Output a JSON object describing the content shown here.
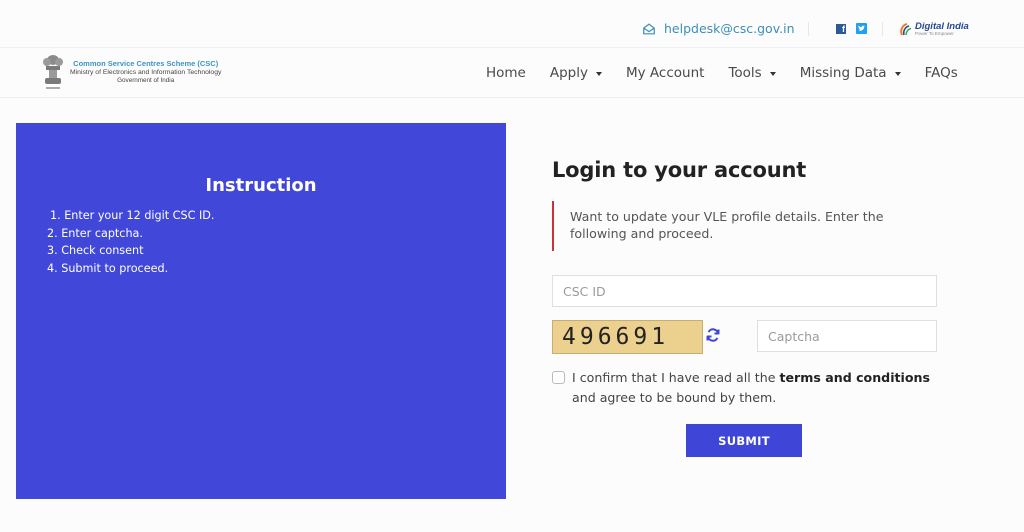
{
  "topbar": {
    "email": "helpdesk@csc.gov.in",
    "social": [
      "facebook",
      "twitter"
    ],
    "digital_india": {
      "title": "Digital India",
      "tagline": "Power To Empower"
    }
  },
  "brand": {
    "line1": "Common Service Centres Scheme (CSC)",
    "line2": "Ministry of Electronics and Information Technology",
    "line3": "Government of India"
  },
  "nav": {
    "items": [
      {
        "label": "Home",
        "dropdown": false
      },
      {
        "label": "Apply",
        "dropdown": true
      },
      {
        "label": "My Account",
        "dropdown": false
      },
      {
        "label": "Tools",
        "dropdown": true
      },
      {
        "label": "Missing Data",
        "dropdown": true
      },
      {
        "label": "FAQs",
        "dropdown": false
      }
    ]
  },
  "instructions": {
    "title": "Instruction",
    "steps": [
      "1. Enter your 12 digit CSC ID.",
      "2. Enter captcha.",
      "3. Check consent",
      "4. Submit to proceed."
    ]
  },
  "login": {
    "title": "Login to your account",
    "notice": "Want to update your VLE profile details. Enter the following and proceed.",
    "csc_id": {
      "placeholder": "CSC ID",
      "value": ""
    },
    "captcha_code": "496691",
    "captcha": {
      "placeholder": "Captcha",
      "value": ""
    },
    "consent": {
      "prefix": "I confirm that I have read all the ",
      "link": "terms and conditions",
      "suffix": " and agree to be bound by them.",
      "checked": false
    },
    "submit_label": "SUBMIT"
  },
  "colors": {
    "panel_blue": "#4147d9",
    "button_blue": "#3f45d6",
    "notice_border": "#c8323c",
    "captcha_bg": "#ecd08e",
    "email_color": "#3d8fb6"
  }
}
